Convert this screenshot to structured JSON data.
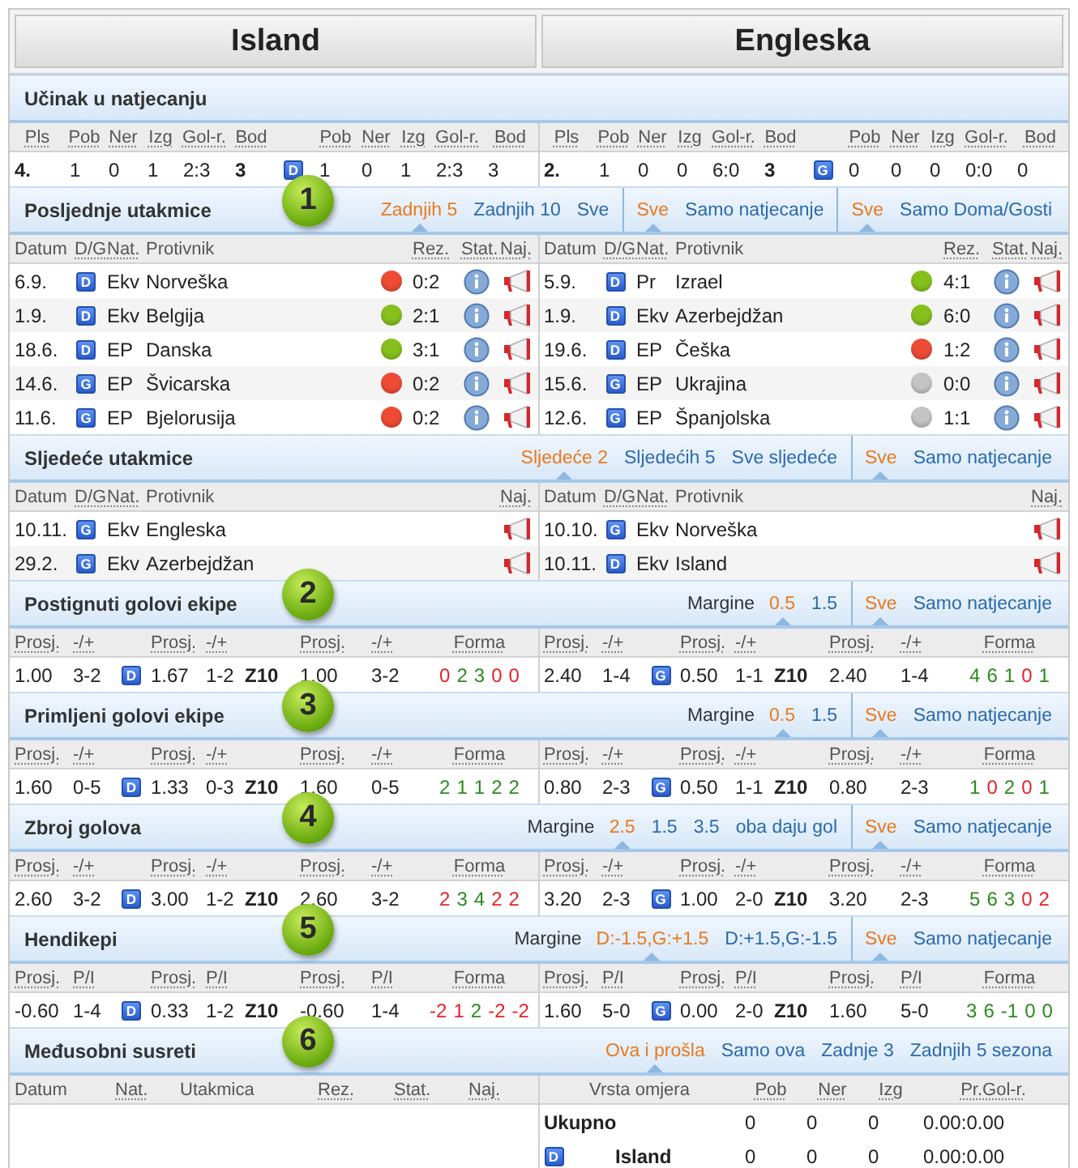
{
  "teams": [
    {
      "name": "Island"
    },
    {
      "name": "Engleska"
    }
  ],
  "sections": [
    {
      "kind": "standings",
      "title": "Učinak u natjecanju",
      "halves": [
        {
          "columns": [
            {
              "label": "Pls"
            },
            {
              "label": "Pob"
            },
            {
              "label": "Ner"
            },
            {
              "label": "Izg"
            },
            {
              "label": "Gol-r."
            },
            {
              "label": "Bod"
            },
            null,
            {
              "label": "Pob"
            },
            {
              "label": "Ner"
            },
            {
              "label": "Izg"
            },
            {
              "label": "Gol-r."
            },
            {
              "label": "Bod"
            }
          ],
          "row": [
            {
              "kind": "strong",
              "text": "4."
            },
            {
              "kind": "plain",
              "text": "1"
            },
            {
              "kind": "plain",
              "text": "0"
            },
            {
              "kind": "plain",
              "text": "1"
            },
            {
              "kind": "plain",
              "text": "2:3"
            },
            {
              "kind": "strong",
              "text": "3"
            },
            {
              "kind": "venue",
              "text": "D"
            },
            {
              "kind": "plain",
              "text": "1"
            },
            {
              "kind": "plain",
              "text": "0"
            },
            {
              "kind": "plain",
              "text": "1"
            },
            {
              "kind": "plain",
              "text": "2:3"
            },
            {
              "kind": "plain",
              "text": "3"
            }
          ]
        },
        {
          "columns": [
            {
              "label": "Pls"
            },
            {
              "label": "Pob"
            },
            {
              "label": "Ner"
            },
            {
              "label": "Izg"
            },
            {
              "label": "Gol-r."
            },
            {
              "label": "Bod"
            },
            null,
            {
              "label": "Pob"
            },
            {
              "label": "Ner"
            },
            {
              "label": "Izg"
            },
            {
              "label": "Gol-r."
            },
            {
              "label": "Bod"
            }
          ],
          "row": [
            {
              "kind": "strong",
              "text": "2."
            },
            {
              "kind": "plain",
              "text": "1"
            },
            {
              "kind": "plain",
              "text": "0"
            },
            {
              "kind": "plain",
              "text": "0"
            },
            {
              "kind": "plain",
              "text": "6:0"
            },
            {
              "kind": "strong",
              "text": "3"
            },
            {
              "kind": "venue",
              "text": "G"
            },
            {
              "kind": "plain",
              "text": "0"
            },
            {
              "kind": "plain",
              "text": "0"
            },
            {
              "kind": "plain",
              "text": "0"
            },
            {
              "kind": "plain",
              "text": "0:0"
            },
            {
              "kind": "plain",
              "text": "0"
            }
          ]
        }
      ]
    },
    {
      "kind": "matches",
      "title": "Posljednje utakmice",
      "step": "1",
      "groups": [
        {
          "tabs": [
            {
              "label": "Zadnjih 5",
              "selected": true
            },
            {
              "label": "Zadnjih 10",
              "selected": false
            },
            {
              "label": "Sve",
              "selected": false
            }
          ]
        },
        {
          "tabs": [
            {
              "label": "Sve",
              "selected": true
            },
            {
              "label": "Samo natjecanje",
              "selected": false
            }
          ]
        },
        {
          "tabs": [
            {
              "label": "Sve",
              "selected": true
            },
            {
              "label": "Samo Doma/Gosti",
              "selected": false
            }
          ]
        }
      ],
      "halves": [
        {
          "columns": [
            {
              "label": "Datum",
              "abbr": false
            },
            {
              "label": "D/G",
              "abbr": true
            },
            {
              "label": "Nat.",
              "abbr": true
            },
            {
              "label": "Protivnik",
              "abbr": false
            },
            {
              "label": "Rez.",
              "abbr": true
            },
            {
              "label": "Stat.",
              "abbr": true
            },
            {
              "label": "Naj.",
              "abbr": true
            }
          ],
          "rows": [
            {
              "date": "6.9.",
              "venue": "D",
              "competition": "Ekv",
              "opponent": "Norveška",
              "color": "#ee4b35",
              "score": "0:2"
            },
            {
              "date": "1.9.",
              "venue": "D",
              "competition": "Ekv",
              "opponent": "Belgija",
              "color": "#86c01c",
              "score": "2:1"
            },
            {
              "date": "18.6.",
              "venue": "D",
              "competition": "EP",
              "opponent": "Danska",
              "color": "#86c01c",
              "score": "3:1"
            },
            {
              "date": "14.6.",
              "venue": "G",
              "competition": "EP",
              "opponent": "Švicarska",
              "color": "#ee4b35",
              "score": "0:2"
            },
            {
              "date": "11.6.",
              "venue": "G",
              "competition": "EP",
              "opponent": "Bjelorusija",
              "color": "#ee4b35",
              "score": "0:2"
            }
          ]
        },
        {
          "columns": [
            {
              "label": "Datum",
              "abbr": false
            },
            {
              "label": "D/G",
              "abbr": true
            },
            {
              "label": "Nat.",
              "abbr": true
            },
            {
              "label": "Protivnik",
              "abbr": false
            },
            {
              "label": "Rez.",
              "abbr": true
            },
            {
              "label": "Stat.",
              "abbr": true
            },
            {
              "label": "Naj.",
              "abbr": true
            }
          ],
          "rows": [
            {
              "date": "5.9.",
              "venue": "D",
              "competition": "Pr",
              "opponent": "Izrael",
              "color": "#86c01c",
              "score": "4:1"
            },
            {
              "date": "1.9.",
              "venue": "D",
              "competition": "Ekv",
              "opponent": "Azerbejdžan",
              "color": "#86c01c",
              "score": "6:0"
            },
            {
              "date": "19.6.",
              "venue": "D",
              "competition": "EP",
              "opponent": "Češka",
              "color": "#ee4b35",
              "score": "1:2"
            },
            {
              "date": "15.6.",
              "venue": "G",
              "competition": "EP",
              "opponent": "Ukrajina",
              "color": "#c4c4c4",
              "score": "0:0"
            },
            {
              "date": "12.6.",
              "venue": "G",
              "competition": "EP",
              "opponent": "Španjolska",
              "color": "#c4c4c4",
              "score": "1:1"
            }
          ]
        }
      ]
    },
    {
      "kind": "fixtures",
      "title": "Sljedeće utakmice",
      "groups": [
        {
          "tabs": [
            {
              "label": "Sljedeće 2",
              "selected": true
            },
            {
              "label": "Sljedećih 5",
              "selected": false
            },
            {
              "label": "Sve sljedeće",
              "selected": false
            }
          ]
        },
        {
          "tabs": [
            {
              "label": "Sve",
              "selected": true
            },
            {
              "label": "Samo natjecanje",
              "selected": false
            }
          ]
        }
      ],
      "halves": [
        {
          "columns": [
            {
              "label": "Datum",
              "abbr": false
            },
            {
              "label": "D/G",
              "abbr": true
            },
            {
              "label": "Nat.",
              "abbr": true
            },
            {
              "label": "Protivnik",
              "abbr": false
            },
            {
              "label": "Naj.",
              "abbr": true
            }
          ],
          "rows": [
            {
              "date": "10.11.",
              "venue": "G",
              "competition": "Ekv",
              "opponent": "Engleska"
            },
            {
              "date": "29.2.",
              "venue": "G",
              "competition": "Ekv",
              "opponent": "Azerbejdžan"
            }
          ]
        },
        {
          "columns": [
            {
              "label": "Datum",
              "abbr": false
            },
            {
              "label": "D/G",
              "abbr": true
            },
            {
              "label": "Nat.",
              "abbr": true
            },
            {
              "label": "Protivnik",
              "abbr": false
            },
            {
              "label": "Naj.",
              "abbr": true
            }
          ],
          "rows": [
            {
              "date": "10.10.",
              "venue": "G",
              "competition": "Ekv",
              "opponent": "Norveška"
            },
            {
              "date": "10.11.",
              "venue": "D",
              "competition": "Ekv",
              "opponent": "Island"
            }
          ]
        }
      ]
    },
    {
      "kind": "goals",
      "title": "Postignuti golovi ekipe",
      "step": "2",
      "groups": [
        {
          "label": "Margine",
          "tabs": [
            {
              "label": "0.5",
              "selected": true
            },
            {
              "label": "1.5",
              "selected": false
            }
          ]
        },
        {
          "tabs": [
            {
              "label": "Sve",
              "selected": true
            },
            {
              "label": "Samo natjecanje",
              "selected": false
            }
          ]
        }
      ],
      "halves": [
        {
          "columns": [
            {
              "label": "Prosj."
            },
            {
              "label": "-/+"
            },
            null,
            {
              "label": "Prosj."
            },
            {
              "label": "-/+"
            },
            null,
            {
              "label": "Prosj."
            },
            {
              "label": "-/+"
            },
            {
              "label": "Forma"
            }
          ],
          "row": [
            {
              "kind": "plain",
              "text": "1.00"
            },
            {
              "kind": "plain",
              "text": "3-2"
            },
            {
              "kind": "venue",
              "text": "D"
            },
            {
              "kind": "plain",
              "text": "1.67"
            },
            {
              "kind": "plain",
              "text": "1-2"
            },
            {
              "kind": "strong",
              "text": "Z10"
            },
            {
              "kind": "plain",
              "text": "1.00"
            },
            {
              "kind": "plain",
              "text": "3-2"
            },
            {
              "kind": "form",
              "items": [
                {
                  "text": "0",
                  "color": "#e8202a"
                },
                {
                  "text": "2",
                  "color": "#2a8a1e"
                },
                {
                  "text": "3",
                  "color": "#2a8a1e"
                },
                {
                  "text": "0",
                  "color": "#e8202a"
                },
                {
                  "text": "0",
                  "color": "#e8202a"
                }
              ]
            }
          ]
        },
        {
          "columns": [
            {
              "label": "Prosj."
            },
            {
              "label": "-/+"
            },
            null,
            {
              "label": "Prosj."
            },
            {
              "label": "-/+"
            },
            null,
            {
              "label": "Prosj."
            },
            {
              "label": "-/+"
            },
            {
              "label": "Forma"
            }
          ],
          "row": [
            {
              "kind": "plain",
              "text": "2.40"
            },
            {
              "kind": "plain",
              "text": "1-4"
            },
            {
              "kind": "venue",
              "text": "G"
            },
            {
              "kind": "plain",
              "text": "0.50"
            },
            {
              "kind": "plain",
              "text": "1-1"
            },
            {
              "kind": "strong",
              "text": "Z10"
            },
            {
              "kind": "plain",
              "text": "2.40"
            },
            {
              "kind": "plain",
              "text": "1-4"
            },
            {
              "kind": "form",
              "items": [
                {
                  "text": "4",
                  "color": "#2a8a1e"
                },
                {
                  "text": "6",
                  "color": "#2a8a1e"
                },
                {
                  "text": "1",
                  "color": "#2a8a1e"
                },
                {
                  "text": "0",
                  "color": "#e8202a"
                },
                {
                  "text": "1",
                  "color": "#2a8a1e"
                }
              ]
            }
          ]
        }
      ]
    },
    {
      "kind": "goals",
      "title": "Primljeni golovi ekipe",
      "step": "3",
      "groups": [
        {
          "label": "Margine",
          "tabs": [
            {
              "label": "0.5",
              "selected": true
            },
            {
              "label": "1.5",
              "selected": false
            }
          ]
        },
        {
          "tabs": [
            {
              "label": "Sve",
              "selected": true
            },
            {
              "label": "Samo natjecanje",
              "selected": false
            }
          ]
        }
      ],
      "halves": [
        {
          "columns": [
            {
              "label": "Prosj."
            },
            {
              "label": "-/+"
            },
            null,
            {
              "label": "Prosj."
            },
            {
              "label": "-/+"
            },
            null,
            {
              "label": "Prosj."
            },
            {
              "label": "-/+"
            },
            {
              "label": "Forma"
            }
          ],
          "row": [
            {
              "kind": "plain",
              "text": "1.60"
            },
            {
              "kind": "plain",
              "text": "0-5"
            },
            {
              "kind": "venue",
              "text": "D"
            },
            {
              "kind": "plain",
              "text": "1.33"
            },
            {
              "kind": "plain",
              "text": "0-3"
            },
            {
              "kind": "strong",
              "text": "Z10"
            },
            {
              "kind": "plain",
              "text": "1.60"
            },
            {
              "kind": "plain",
              "text": "0-5"
            },
            {
              "kind": "form",
              "items": [
                {
                  "text": "2",
                  "color": "#2a8a1e"
                },
                {
                  "text": "1",
                  "color": "#2a8a1e"
                },
                {
                  "text": "1",
                  "color": "#2a8a1e"
                },
                {
                  "text": "2",
                  "color": "#2a8a1e"
                },
                {
                  "text": "2",
                  "color": "#2a8a1e"
                }
              ]
            }
          ]
        },
        {
          "columns": [
            {
              "label": "Prosj."
            },
            {
              "label": "-/+"
            },
            null,
            {
              "label": "Prosj."
            },
            {
              "label": "-/+"
            },
            null,
            {
              "label": "Prosj."
            },
            {
              "label": "-/+"
            },
            {
              "label": "Forma"
            }
          ],
          "row": [
            {
              "kind": "plain",
              "text": "0.80"
            },
            {
              "kind": "plain",
              "text": "2-3"
            },
            {
              "kind": "venue",
              "text": "G"
            },
            {
              "kind": "plain",
              "text": "0.50"
            },
            {
              "kind": "plain",
              "text": "1-1"
            },
            {
              "kind": "strong",
              "text": "Z10"
            },
            {
              "kind": "plain",
              "text": "0.80"
            },
            {
              "kind": "plain",
              "text": "2-3"
            },
            {
              "kind": "form",
              "items": [
                {
                  "text": "1",
                  "color": "#2a8a1e"
                },
                {
                  "text": "0",
                  "color": "#e8202a"
                },
                {
                  "text": "2",
                  "color": "#2a8a1e"
                },
                {
                  "text": "0",
                  "color": "#e8202a"
                },
                {
                  "text": "1",
                  "color": "#2a8a1e"
                }
              ]
            }
          ]
        }
      ]
    },
    {
      "kind": "goals",
      "title": "Zbroj golova",
      "step": "4",
      "groups": [
        {
          "label": "Margine",
          "tabs": [
            {
              "label": "2.5",
              "selected": true
            },
            {
              "label": "1.5",
              "selected": false
            },
            {
              "label": "3.5",
              "selected": false
            },
            {
              "label": "oba daju gol",
              "selected": false
            }
          ]
        },
        {
          "tabs": [
            {
              "label": "Sve",
              "selected": true
            },
            {
              "label": "Samo natjecanje",
              "selected": false
            }
          ]
        }
      ],
      "halves": [
        {
          "columns": [
            {
              "label": "Prosj."
            },
            {
              "label": "-/+"
            },
            null,
            {
              "label": "Prosj."
            },
            {
              "label": "-/+"
            },
            null,
            {
              "label": "Prosj."
            },
            {
              "label": "-/+"
            },
            {
              "label": "Forma"
            }
          ],
          "row": [
            {
              "kind": "plain",
              "text": "2.60"
            },
            {
              "kind": "plain",
              "text": "3-2"
            },
            {
              "kind": "venue",
              "text": "D"
            },
            {
              "kind": "plain",
              "text": "3.00"
            },
            {
              "kind": "plain",
              "text": "1-2"
            },
            {
              "kind": "strong",
              "text": "Z10"
            },
            {
              "kind": "plain",
              "text": "2.60"
            },
            {
              "kind": "plain",
              "text": "3-2"
            },
            {
              "kind": "form",
              "items": [
                {
                  "text": "2",
                  "color": "#e8202a"
                },
                {
                  "text": "3",
                  "color": "#2a8a1e"
                },
                {
                  "text": "4",
                  "color": "#2a8a1e"
                },
                {
                  "text": "2",
                  "color": "#e8202a"
                },
                {
                  "text": "2",
                  "color": "#e8202a"
                }
              ]
            }
          ]
        },
        {
          "columns": [
            {
              "label": "Prosj."
            },
            {
              "label": "-/+"
            },
            null,
            {
              "label": "Prosj."
            },
            {
              "label": "-/+"
            },
            null,
            {
              "label": "Prosj."
            },
            {
              "label": "-/+"
            },
            {
              "label": "Forma"
            }
          ],
          "row": [
            {
              "kind": "plain",
              "text": "3.20"
            },
            {
              "kind": "plain",
              "text": "2-3"
            },
            {
              "kind": "venue",
              "text": "G"
            },
            {
              "kind": "plain",
              "text": "1.00"
            },
            {
              "kind": "plain",
              "text": "2-0"
            },
            {
              "kind": "strong",
              "text": "Z10"
            },
            {
              "kind": "plain",
              "text": "3.20"
            },
            {
              "kind": "plain",
              "text": "2-3"
            },
            {
              "kind": "form",
              "items": [
                {
                  "text": "5",
                  "color": "#2a8a1e"
                },
                {
                  "text": "6",
                  "color": "#2a8a1e"
                },
                {
                  "text": "3",
                  "color": "#2a8a1e"
                },
                {
                  "text": "0",
                  "color": "#e8202a"
                },
                {
                  "text": "2",
                  "color": "#e8202a"
                }
              ]
            }
          ]
        }
      ]
    },
    {
      "kind": "goals",
      "title": "Hendikepi",
      "step": "5",
      "groups": [
        {
          "label": "Margine",
          "tabs": [
            {
              "label": "D:-1.5,G:+1.5",
              "selected": true
            },
            {
              "label": "D:+1.5,G:-1.5",
              "selected": false
            }
          ]
        },
        {
          "tabs": [
            {
              "label": "Sve",
              "selected": true
            },
            {
              "label": "Samo natjecanje",
              "selected": false
            }
          ]
        }
      ],
      "halves": [
        {
          "columns": [
            {
              "label": "Prosj."
            },
            {
              "label": "P/I"
            },
            null,
            {
              "label": "Prosj."
            },
            {
              "label": "P/I"
            },
            null,
            {
              "label": "Prosj."
            },
            {
              "label": "P/I"
            },
            {
              "label": "Forma"
            }
          ],
          "row": [
            {
              "kind": "plain",
              "text": "-0.60"
            },
            {
              "kind": "plain",
              "text": "1-4"
            },
            {
              "kind": "venue",
              "text": "D"
            },
            {
              "kind": "plain",
              "text": "0.33"
            },
            {
              "kind": "plain",
              "text": "1-2"
            },
            {
              "kind": "strong",
              "text": "Z10"
            },
            {
              "kind": "plain",
              "text": "-0.60"
            },
            {
              "kind": "plain",
              "text": "1-4"
            },
            {
              "kind": "form",
              "items": [
                {
                  "text": "-2",
                  "color": "#e8202a"
                },
                {
                  "text": "1",
                  "color": "#e8202a"
                },
                {
                  "text": "2",
                  "color": "#2a8a1e"
                },
                {
                  "text": "-2",
                  "color": "#e8202a"
                },
                {
                  "text": "-2",
                  "color": "#e8202a"
                }
              ]
            }
          ]
        },
        {
          "columns": [
            {
              "label": "Prosj."
            },
            {
              "label": "P/I"
            },
            null,
            {
              "label": "Prosj."
            },
            {
              "label": "P/I"
            },
            null,
            {
              "label": "Prosj."
            },
            {
              "label": "P/I"
            },
            {
              "label": "Forma"
            }
          ],
          "row": [
            {
              "kind": "plain",
              "text": "1.60"
            },
            {
              "kind": "plain",
              "text": "5-0"
            },
            {
              "kind": "venue",
              "text": "G"
            },
            {
              "kind": "plain",
              "text": "0.00"
            },
            {
              "kind": "plain",
              "text": "2-0"
            },
            {
              "kind": "strong",
              "text": "Z10"
            },
            {
              "kind": "plain",
              "text": "1.60"
            },
            {
              "kind": "plain",
              "text": "5-0"
            },
            {
              "kind": "form",
              "items": [
                {
                  "text": "3",
                  "color": "#2a8a1e"
                },
                {
                  "text": "6",
                  "color": "#2a8a1e"
                },
                {
                  "text": "-1",
                  "color": "#2a8a1e"
                },
                {
                  "text": "0",
                  "color": "#2a8a1e"
                },
                {
                  "text": "0",
                  "color": "#2a8a1e"
                }
              ]
            }
          ]
        }
      ]
    },
    {
      "kind": "h2h",
      "title": "Međusobni susreti",
      "step": "6",
      "groups": [
        {
          "tabs": [
            {
              "label": "Ova i prošla",
              "selected": true
            },
            {
              "label": "Samo ova",
              "selected": false
            },
            {
              "label": "Zadnje 3",
              "selected": false
            },
            {
              "label": "Zadnjih 5 sezona",
              "selected": false
            }
          ]
        }
      ],
      "halves": [
        {
          "columns": [
            {
              "label": "Datum",
              "abbr": false
            },
            {
              "label": "Nat.",
              "abbr": true
            },
            {
              "label": "Utakmica",
              "abbr": false
            },
            {
              "label": "Rez.",
              "abbr": true
            },
            {
              "label": "Stat.",
              "abbr": true
            },
            {
              "label": "Naj.",
              "abbr": true
            }
          ]
        },
        {
          "columns": [
            {
              "label": "Vrsta omjera",
              "abbr": false
            },
            {
              "label": "Pob",
              "abbr": true
            },
            {
              "label": "Ner",
              "abbr": true
            },
            {
              "label": "Izg",
              "abbr": true
            },
            {
              "label": "Pr.Gol-r.",
              "abbr": true
            }
          ],
          "rows": [
            {
              "label": "Ukupno",
              "values": [
                "0",
                "0",
                "0",
                "0.00:0.00"
              ]
            },
            {
              "venue": "D",
              "label": "Island",
              "values": [
                "0",
                "0",
                "0",
                "0.00:0.00"
              ]
            }
          ]
        }
      ]
    }
  ]
}
